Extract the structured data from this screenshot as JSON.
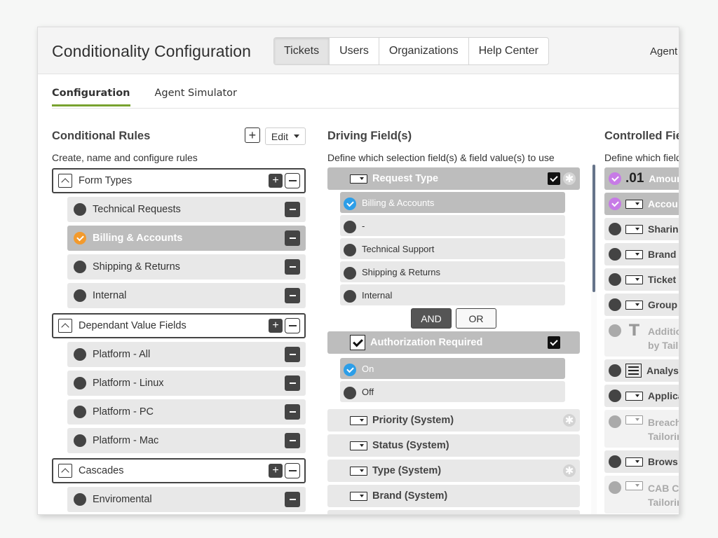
{
  "header": {
    "title": "Conditionality Configuration",
    "nav_tabs": [
      {
        "label": "Tickets",
        "active": true
      },
      {
        "label": "Users",
        "active": false
      },
      {
        "label": "Organizations",
        "active": false
      },
      {
        "label": "Help Center",
        "active": false
      }
    ],
    "agent_link": "Agent"
  },
  "subtabs": [
    {
      "label": "Configuration",
      "active": true
    },
    {
      "label": "Agent Simulator",
      "active": false
    }
  ],
  "conditional_rules": {
    "title": "Conditional Rules",
    "subtitle": "Create, name and configure rules",
    "add_icon": "plus-icon",
    "edit_label": "Edit",
    "groups": [
      {
        "label": "Form Types",
        "rules": [
          {
            "label": "Technical Requests",
            "selected": false
          },
          {
            "label": "Billing & Accounts",
            "selected": true
          },
          {
            "label": "Shipping & Returns",
            "selected": false
          },
          {
            "label": "Internal",
            "selected": false
          }
        ]
      },
      {
        "label": "Dependant Value Fields",
        "rules": [
          {
            "label": "Platform - All",
            "selected": false
          },
          {
            "label": "Platform - Linux",
            "selected": false
          },
          {
            "label": "Platform - PC",
            "selected": false
          },
          {
            "label": "Platform - Mac",
            "selected": false
          }
        ]
      },
      {
        "label": "Cascades",
        "rules": [
          {
            "label": "Enviromental",
            "selected": false
          }
        ]
      }
    ]
  },
  "driving_fields": {
    "title": "Driving Field(s)",
    "subtitle": "Define which selection field(s) & field value(s) to use",
    "request_type": {
      "label": "Request Type",
      "icon": "dropdown-field-icon",
      "checked": true,
      "values": [
        {
          "label": "Billing & Accounts",
          "selected": true
        },
        {
          "label": "-",
          "selected": false
        },
        {
          "label": "Technical Support",
          "selected": false
        },
        {
          "label": "Shipping & Returns",
          "selected": false
        },
        {
          "label": "Internal",
          "selected": false
        }
      ]
    },
    "operator": {
      "and_label": "AND",
      "or_label": "OR",
      "selected": "AND"
    },
    "authorization": {
      "label": "Authorization Required",
      "icon": "checkbox-field-icon",
      "checked": true,
      "values": [
        {
          "label": "On",
          "selected": true
        },
        {
          "label": "Off",
          "selected": false
        }
      ]
    },
    "other_fields": [
      {
        "label": "Priority (System)",
        "star": true
      },
      {
        "label": "Status (System)",
        "star": false
      },
      {
        "label": "Type (System)",
        "star": true
      },
      {
        "label": "Brand (System)",
        "star": false
      }
    ]
  },
  "controlled_fields": {
    "title": "Controlled Fie",
    "subtitle": "Define which field",
    "number_icon_text": ".01",
    "items": [
      {
        "label": "Amour",
        "icon": "number",
        "state": "selected"
      },
      {
        "label": "Accou",
        "icon": "dropdown",
        "state": "selected"
      },
      {
        "label": "Sharin",
        "icon": "dropdown",
        "state": "normal"
      },
      {
        "label": "Brand",
        "icon": "dropdown",
        "state": "normal"
      },
      {
        "label": "Ticket",
        "icon": "dropdown",
        "state": "normal"
      },
      {
        "label": "Group",
        "icon": "dropdown",
        "state": "normal"
      },
      {
        "label": "Additio",
        "label2": "by Tail",
        "icon": "text",
        "state": "disabled"
      },
      {
        "label": "Analys",
        "icon": "multiline",
        "state": "normal"
      },
      {
        "label": "Applica",
        "icon": "dropdown",
        "state": "normal"
      },
      {
        "label": "Breach",
        "label2": "Tailorir",
        "icon": "dropdown",
        "state": "disabled"
      },
      {
        "label": "Brows",
        "icon": "dropdown",
        "state": "normal"
      },
      {
        "label": "CAB C",
        "label2": "Tailorir",
        "icon": "dropdown",
        "state": "disabled"
      }
    ]
  }
}
